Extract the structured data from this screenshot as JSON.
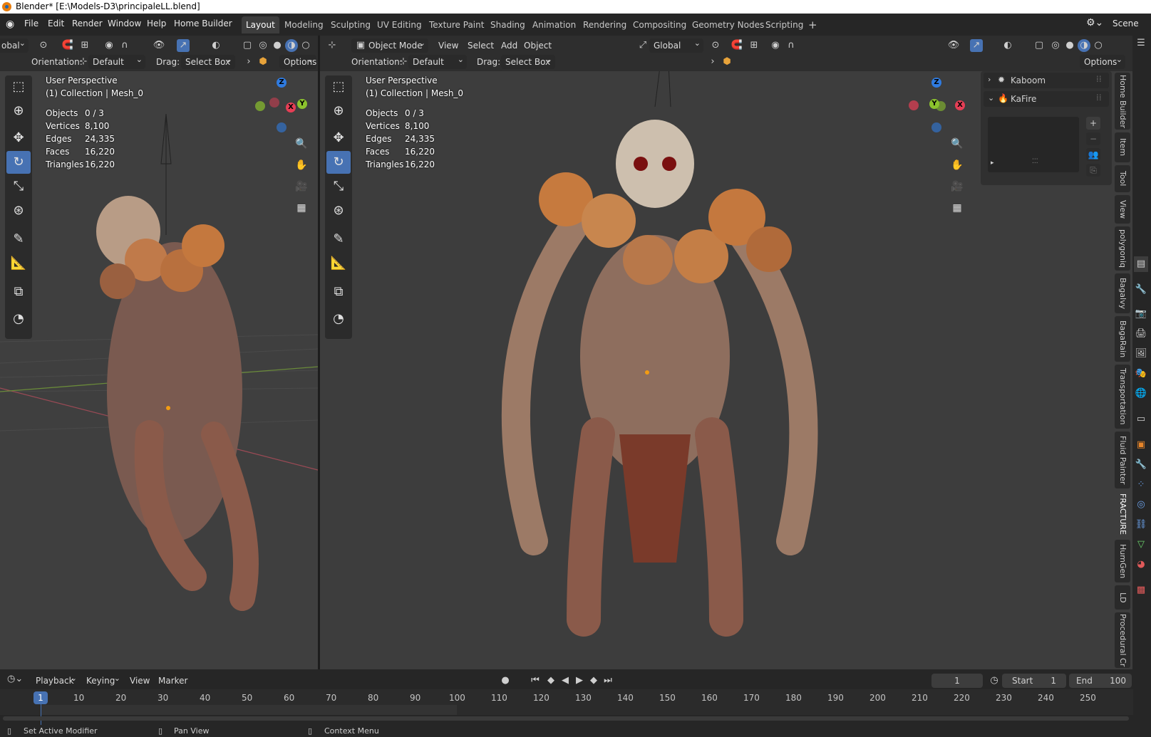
{
  "window": {
    "title": "Blender* [E:\\Models-D3\\principaleLL.blend]"
  },
  "menubar": {
    "items": [
      "File",
      "Edit",
      "Render",
      "Window",
      "Help",
      "Home Builder"
    ],
    "workspaces": [
      "Layout",
      "Modeling",
      "Sculpting",
      "UV Editing",
      "Texture Paint",
      "Shading",
      "Animation",
      "Rendering",
      "Compositing",
      "Geometry Nodes",
      "Scripting"
    ],
    "active_workspace": "Layout",
    "add_tab": "+",
    "scene_label": "Scene"
  },
  "left_viewport": {
    "transform_orientation": "obal",
    "orientation_label": "Orientation:",
    "orientation_value": "Default",
    "drag_label": "Drag:",
    "drag_value": "Select Box",
    "options": "Options",
    "view_name": "User Perspective",
    "collection": "(1) Collection | Mesh_0",
    "stats": [
      {
        "label": "Objects",
        "value": "0 / 3"
      },
      {
        "label": "Vertices",
        "value": "8,100"
      },
      {
        "label": "Edges",
        "value": "24,335"
      },
      {
        "label": "Faces",
        "value": "16,220"
      },
      {
        "label": "Triangles",
        "value": "16,220"
      }
    ]
  },
  "right_viewport": {
    "mode": "Object Mode",
    "menus": [
      "View",
      "Select",
      "Add",
      "Object"
    ],
    "transform_orientation": "Global",
    "orientation_label": "Orientation:",
    "orientation_value": "Default",
    "drag_label": "Drag:",
    "drag_value": "Select Box",
    "options": "Options",
    "view_name": "User Perspective",
    "collection": "(1) Collection | Mesh_0",
    "stats": [
      {
        "label": "Objects",
        "value": "0 / 3"
      },
      {
        "label": "Vertices",
        "value": "8,100"
      },
      {
        "label": "Edges",
        "value": "24,335"
      },
      {
        "label": "Faces",
        "value": "16,220"
      },
      {
        "label": "Triangles",
        "value": "16,220"
      }
    ]
  },
  "sidebar_panel": {
    "items": [
      "Kaboom",
      "KaFire"
    ]
  },
  "sidebar_tabs": [
    "Home Builder",
    "Item",
    "Tool",
    "View",
    "polygoniq",
    "Bagalvy",
    "BagaRain",
    "Transportation",
    "Fluid Painter",
    "FRACTURE",
    "HumGen",
    "LD",
    "Procedural Cr"
  ],
  "gizmo_axes": {
    "x": "X",
    "y": "Y",
    "z": "Z"
  },
  "timeline": {
    "menus": [
      "Playback",
      "Keying",
      "View",
      "Marker"
    ],
    "current_frame": "1",
    "start_label": "Start",
    "start_value": "1",
    "end_label": "End",
    "end_value": "100",
    "ticks": [
      "1",
      "10",
      "20",
      "30",
      "40",
      "50",
      "60",
      "70",
      "80",
      "90",
      "100",
      "110",
      "120",
      "130",
      "140",
      "150",
      "160",
      "170",
      "180",
      "190",
      "200",
      "210",
      "220",
      "230",
      "240",
      "250"
    ]
  },
  "statusbar": {
    "items": [
      "Set Active Modifier",
      "Pan View",
      "Context Menu"
    ]
  },
  "colors": {
    "accent": "#4772b3",
    "axis_x": "#e63e55",
    "axis_y": "#8bc22d",
    "axis_z": "#2f7be0"
  }
}
